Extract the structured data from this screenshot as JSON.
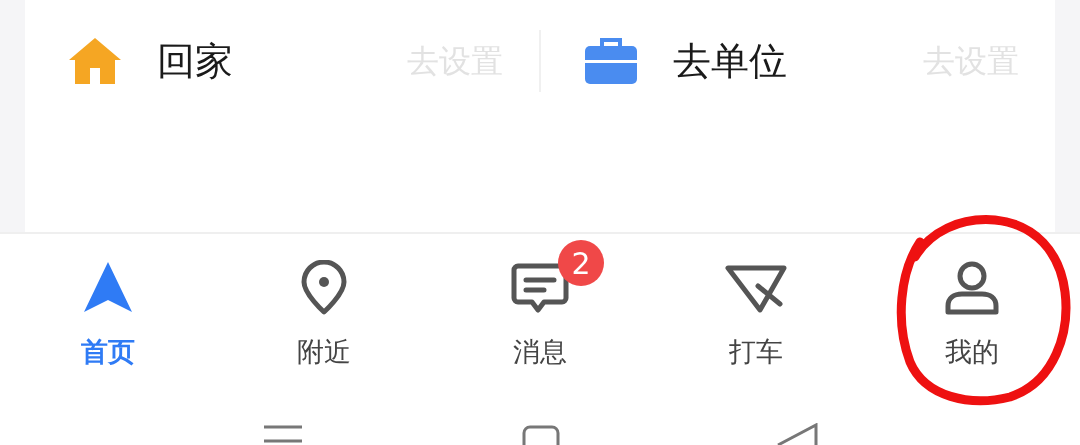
{
  "shortcuts": [
    {
      "kind": "home",
      "label": "回家",
      "action": "去设置"
    },
    {
      "kind": "work",
      "label": "去单位",
      "action": "去设置"
    }
  ],
  "tabs": [
    {
      "kind": "home",
      "label": "首页",
      "selected": true
    },
    {
      "kind": "nearby",
      "label": "附近",
      "selected": false
    },
    {
      "kind": "messages",
      "label": "消息",
      "selected": false,
      "badge": "2"
    },
    {
      "kind": "taxi",
      "label": "打车",
      "selected": false
    },
    {
      "kind": "profile",
      "label": "我的",
      "selected": false
    }
  ]
}
